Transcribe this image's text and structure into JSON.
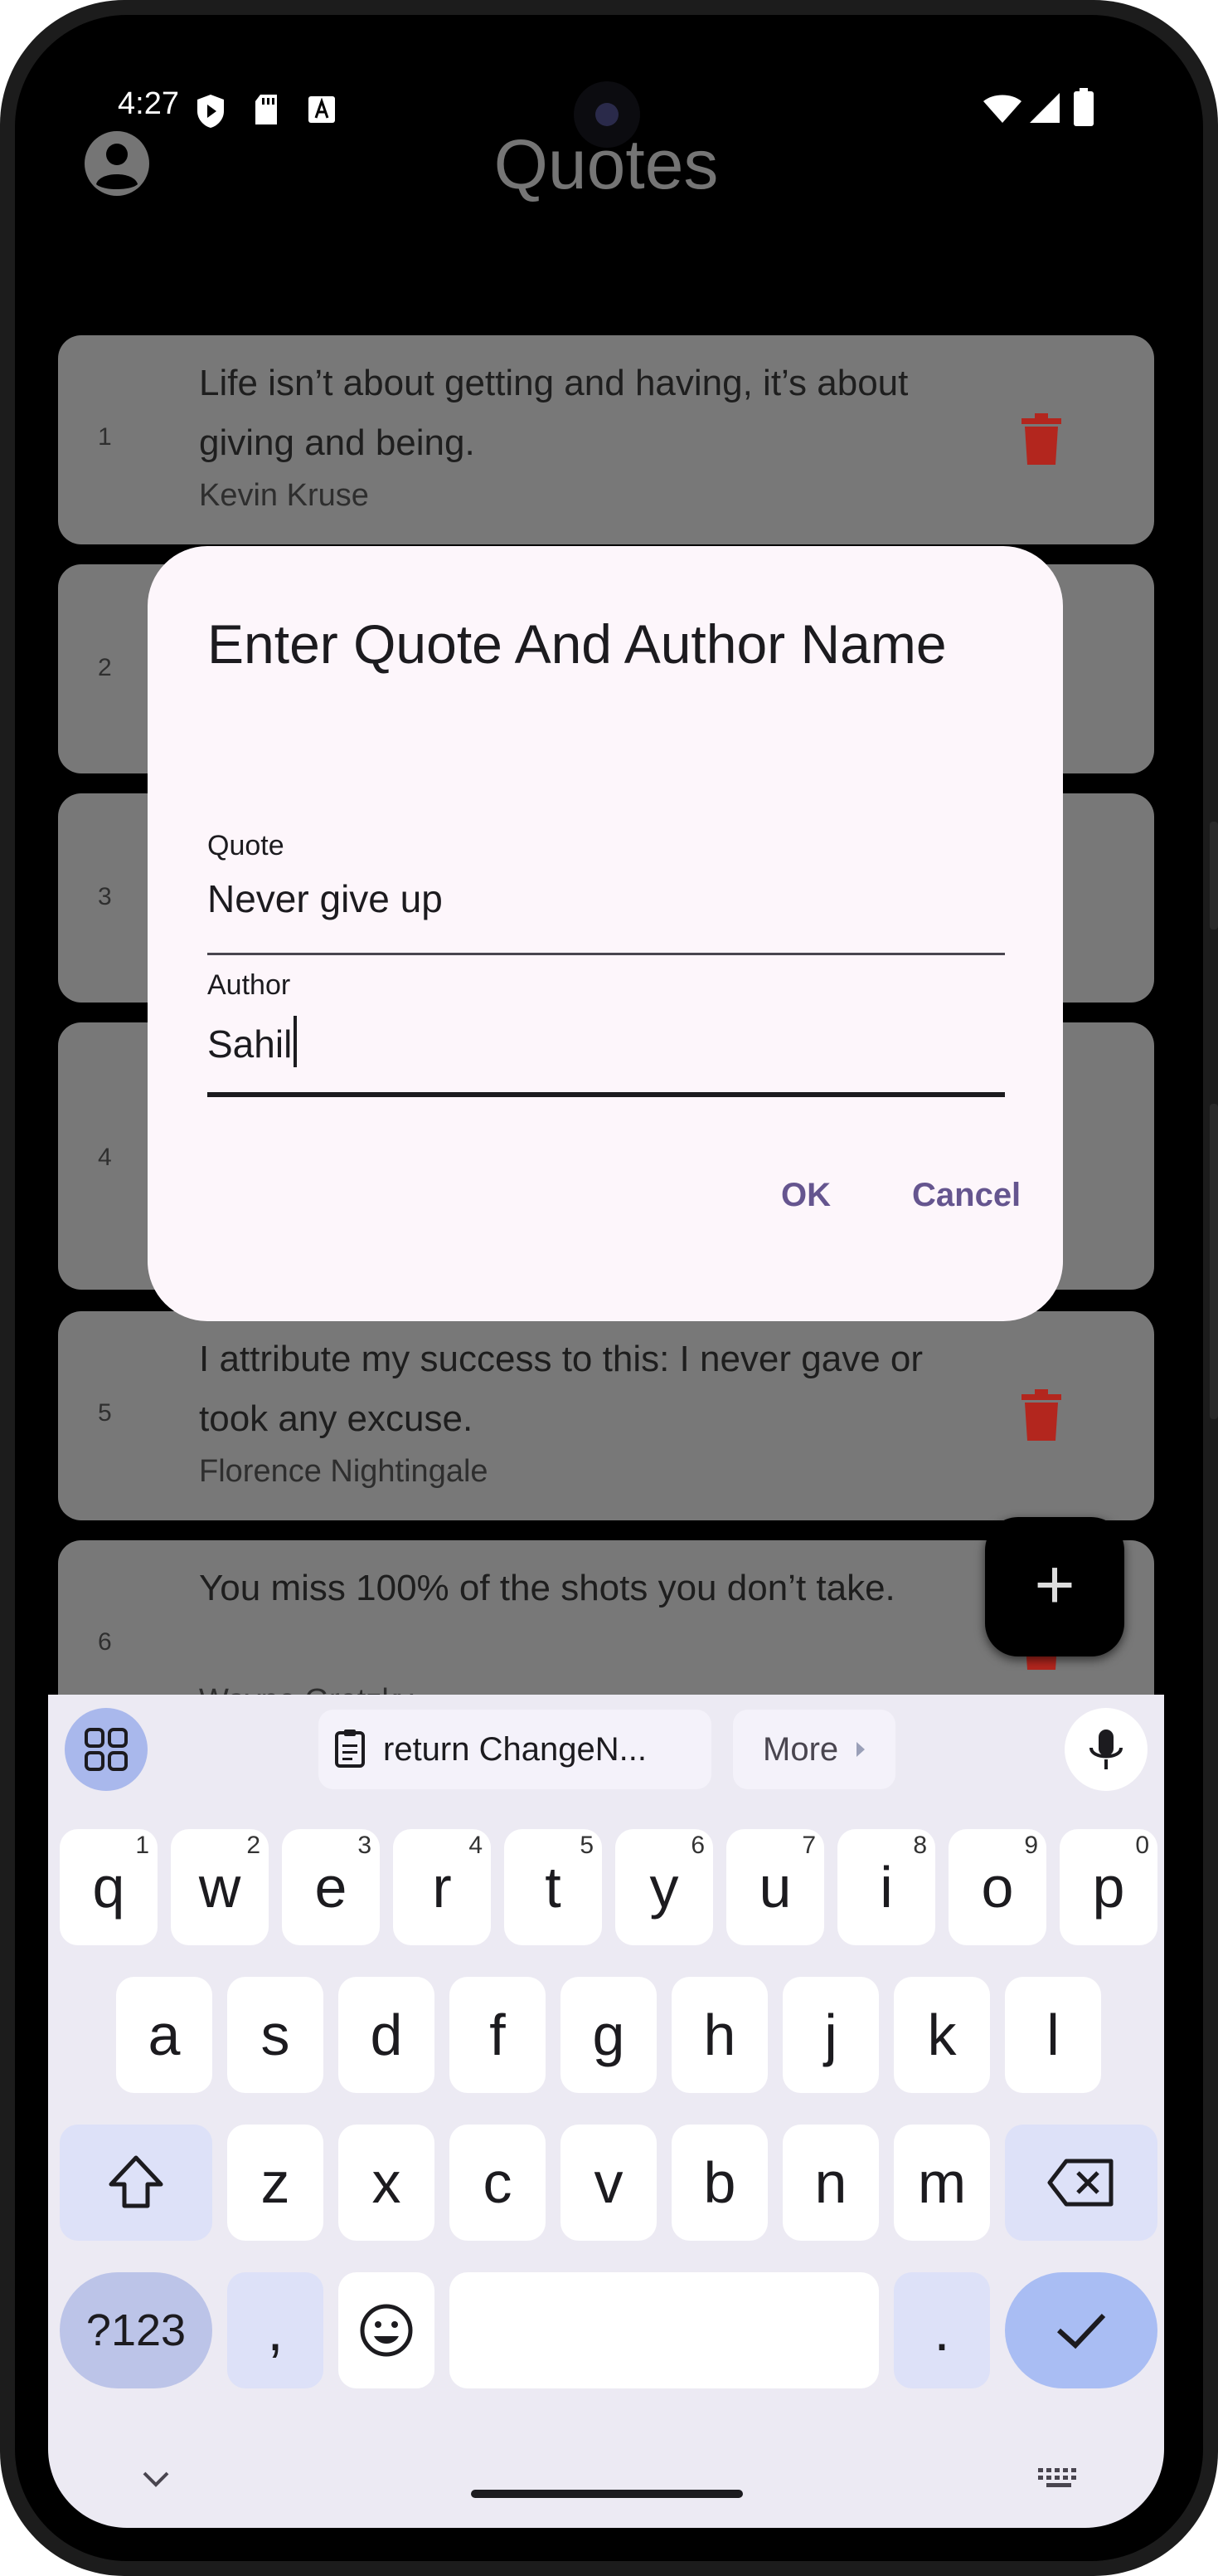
{
  "status_bar": {
    "time": "4:27"
  },
  "app_bar": {
    "title": "Quotes"
  },
  "quotes": [
    {
      "index": "1",
      "quote": "Life isn’t about getting and having, it’s about giving and being.",
      "author": "Kevin Kruse"
    },
    {
      "index": "2",
      "quote": "",
      "author": ""
    },
    {
      "index": "3",
      "quote": "",
      "author": ""
    },
    {
      "index": "4",
      "quote": "",
      "author": ""
    },
    {
      "index": "5",
      "quote": "I attribute my success to this: I never gave or took any excuse.",
      "author": "Florence Nightingale"
    },
    {
      "index": "6",
      "quote": "You miss 100% of the shots you don’t take.",
      "author": "Wayne Gretzky"
    }
  ],
  "dialog": {
    "title": "Enter Quote And Author Name",
    "quote_label": "Quote",
    "quote_value": "Never give up",
    "author_label": "Author",
    "author_value": "Sahil",
    "ok_label": "OK",
    "cancel_label": "Cancel"
  },
  "fab": {
    "icon": "plus-icon"
  },
  "keyboard": {
    "clipboard_suggestion": "return ChangeN...",
    "more_label": "More",
    "row1": [
      {
        "key": "q",
        "hint": "1"
      },
      {
        "key": "w",
        "hint": "2"
      },
      {
        "key": "e",
        "hint": "3"
      },
      {
        "key": "r",
        "hint": "4"
      },
      {
        "key": "t",
        "hint": "5"
      },
      {
        "key": "y",
        "hint": "6"
      },
      {
        "key": "u",
        "hint": "7"
      },
      {
        "key": "i",
        "hint": "8"
      },
      {
        "key": "o",
        "hint": "9"
      },
      {
        "key": "p",
        "hint": "0"
      }
    ],
    "row2": [
      "a",
      "s",
      "d",
      "f",
      "g",
      "h",
      "j",
      "k",
      "l"
    ],
    "row3": [
      "z",
      "x",
      "c",
      "v",
      "b",
      "n",
      "m"
    ],
    "symbols_label": "?123",
    "comma_label": ",",
    "period_label": "."
  },
  "colors": {
    "accent": "#65558f",
    "delete_icon": "#b3261e",
    "dialog_bg": "#fdf6fb",
    "keyboard_bg": "#eceaf3"
  }
}
